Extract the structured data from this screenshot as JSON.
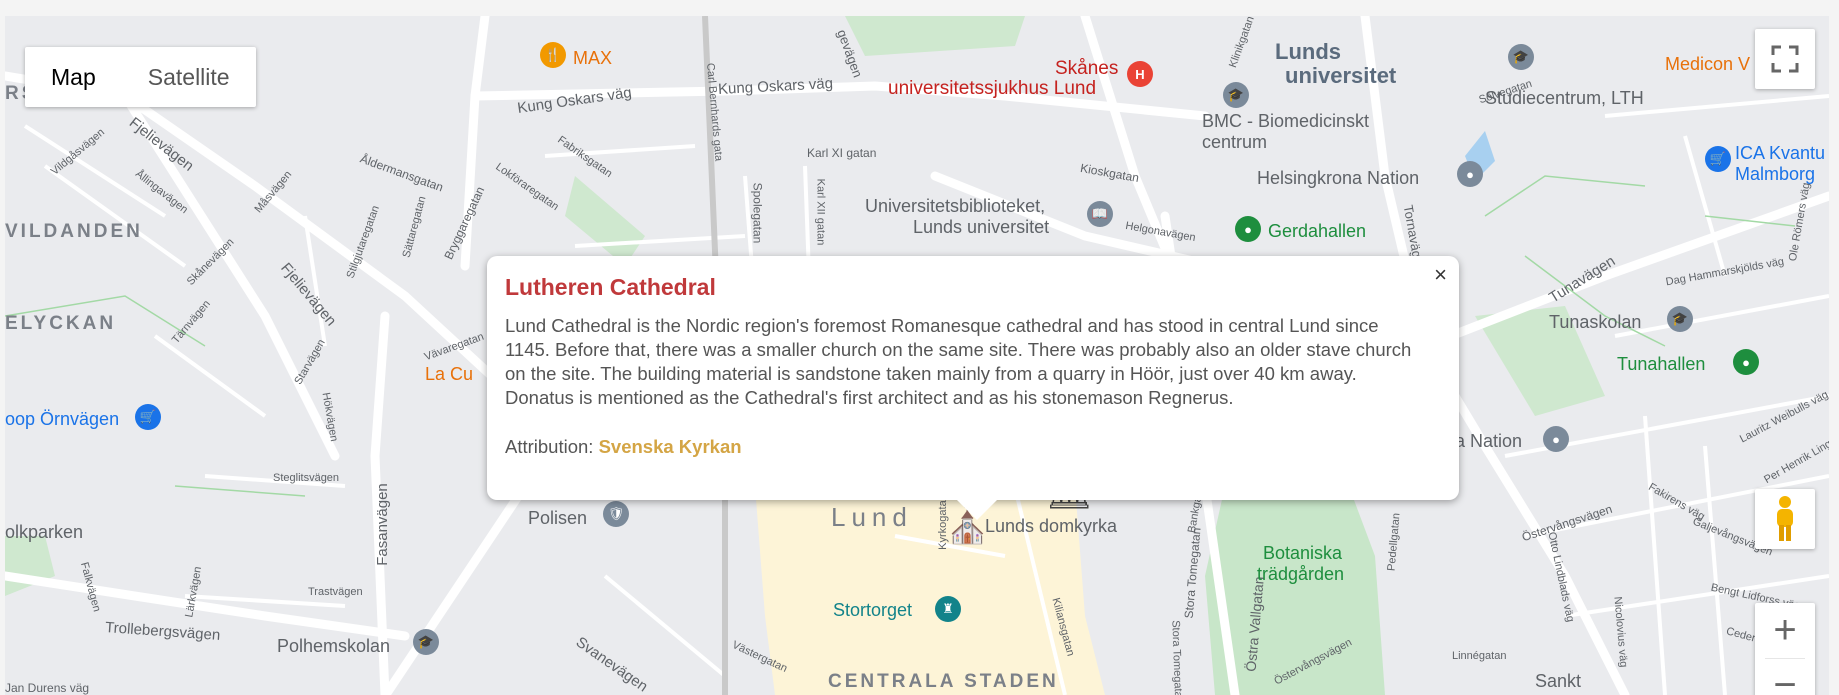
{
  "map_type": {
    "map": "Map",
    "satellite": "Satellite"
  },
  "colors": {
    "old_town": "#fdf4d7",
    "park": "#c8e6c9",
    "road": "#ffffff",
    "popup_title": "#c0393b",
    "attribution_link": "#d4a545"
  },
  "districts": {
    "rs_falad": "RS FALAD",
    "vildanden": "VILDANDEN",
    "elyckan": "ELYCKAN",
    "lund": "Lund",
    "centrala_staden": "CENTRALA STADEN"
  },
  "roads": {
    "kung_oskars_vag_1": "Kung Oskars väg",
    "kung_oskars_vag_2": "Kung Oskars väg",
    "fjelievagen_1": "Fjelievägen",
    "fjelievagen_2": "Fjelievägen",
    "aldermansgatan": "Åldermansgatan",
    "bryggaregatan": "Bryggaregatan",
    "spolegatan": "Spolegatan",
    "karl_xi_gatan": "Karl XI gatan",
    "karl_xii_gatan": "Karl XII gatan",
    "carl_bernhards_gata": "Carl Bernhards gata",
    "vildgasvagen": "Vildgåsvägen",
    "allingavagen": "Ållingavägen",
    "masvagen": "Måsvägen",
    "skanevagen": "Skånevägen",
    "tarnvagen": "Tärnvägen",
    "starvagen": "Starvägen",
    "hokvagen": "Hökvägen",
    "vavaregatan": "Vävaregatan",
    "steglitsvagen": "Steglitsvägen",
    "fasanvagen": "Fasanvägen",
    "trastvagen": "Trastvägen",
    "lärkvagen": "Lärkvägen",
    "falkvagen": "Falkvägen",
    "trollebergsvagen": "Trollebergsvägen",
    "jan_durens_vag": "Jan Durens väg",
    "svanevagen": "Svanevägen",
    "vastergatan": "Västergatan",
    "kyrkogatan": "Kyrkogatan",
    "kiliansgatan": "Kiliansgatan",
    "stora_tomegatan_1": "Stora Tomegatan",
    "stora_tomegatan_2": "Stora Tomegatan",
    "ostra_vallgatan": "Östra Vallgatan",
    "ostervangsvagen_1": "Östervångsvägen",
    "ostervangsvagen_2": "Östervångsvägen",
    "linnegatan": "Linnégatan",
    "kioskgatan": "Kioskgatan",
    "helgonavagen": "Helgonavägen",
    "solvegatan": "Sölvegatan",
    "tunavagen": "Tunavägen",
    "dag_hammarskjolds_vag": "Dag Hammarskjölds väg",
    "lauritz_weibulls_vag": "Lauritz Weibulls väg",
    "per_henrik_ling": "Per Henrik Ling",
    "fakirens_vag": "Fakirens väg",
    "galjevangsvagen": "Galjevångsvägen",
    "bengt_lidforss_vag": "Bengt Lidforss väg",
    "cederborghs_vag": "Cederborghs väg",
    "otto_lindblads_vag": "Otto Lindblads väg",
    "nicolovius_vag": "Nicolovius väg",
    "ole_romers_vag": "Ole Römers väg",
    "pedellgatan": "Pedellgatan",
    "tornavagen": "Tornavägen",
    "lokforaregatan": "Lokföraregatan",
    "fabriksgatan": "Fabriksgatan",
    "sattaregatan": "Sättaregatan",
    "stilgjutaregatan": "Stilgjutaregatan",
    "bankgatan": "Bankgatan",
    "klinikgatan": "Klinikgatan",
    "gevagen": "gevägen"
  },
  "pois": {
    "max": "MAX",
    "skanes_1": "Skånes",
    "skanes_2": "universitetssjukhus Lund",
    "lunds_univ_1": "Lunds",
    "lunds_univ_2": "universitet",
    "bmc_1": "BMC - Biomedicinskt",
    "bmc_2": "centrum",
    "studiecentrum": "Studiecentrum, LTH",
    "medicon": "Medicon V",
    "ica_1": "ICA Kvantu",
    "ica_2": "Malmborg",
    "helsingkrona": "Helsingkrona Nation",
    "ub_1": "Universitetsbiblioteket,",
    "ub_2": "Lunds universitet",
    "gerdahallen": "Gerdahallen",
    "tunaskolan": "Tunaskolan",
    "tunahallen": "Tunahallen",
    "a_nation": "a Nation",
    "la_cu": "La Cu",
    "coop": "oop Örnvägen",
    "polisen": "Polisen",
    "domkyrka": "Lunds domkyrka",
    "botaniska_1": "Botaniska",
    "botaniska_2": "trädgården",
    "stortorget": "Stortorget",
    "polhemskolan": "Polhemskolan",
    "olkparken": "olkparken",
    "sankt": "Sankt"
  },
  "popup": {
    "title": "Lutheren Cathedral",
    "body": "Lund Cathedral is the Nordic region's foremost Romanesque cathedral and has stood in central Lund since 1145. Before that, there was a smaller church on the same site. There was probably also an older stave church on the site. The building material is sandstone taken mainly from a quarry in Höör, just over 40 km away. Donatus is mentioned as the Cathedral's first architect and as his stonemason Regnerus.",
    "attribution_label": "Attribution:",
    "attribution_link": "Svenska Kyrkan",
    "close": "×"
  },
  "controls": {
    "fullscreen_icon": "fullscreen-icon",
    "pegman_icon": "pegman-icon",
    "zoom_in": "+",
    "zoom_out": "−"
  },
  "markers": {
    "church_marker_icon": "church-icon",
    "museum_marker_icon": "museum-icon"
  }
}
